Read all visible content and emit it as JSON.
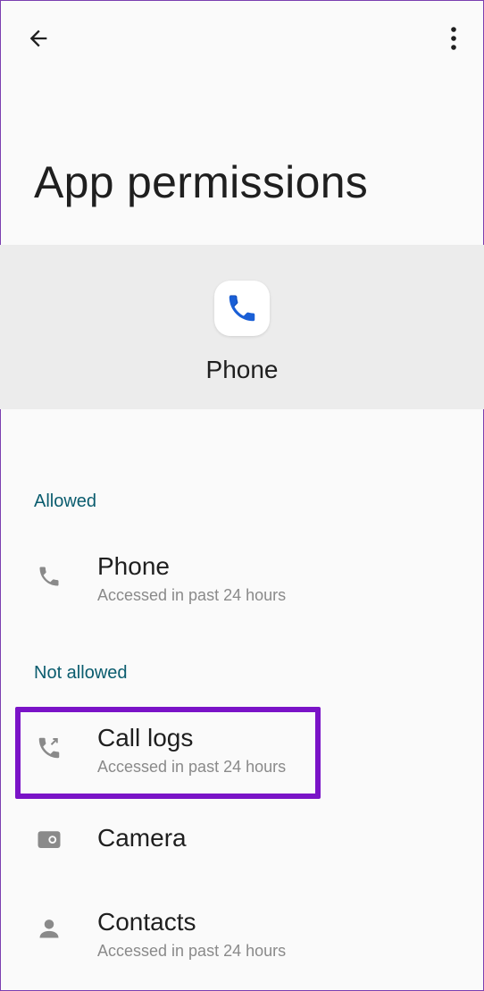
{
  "page": {
    "title": "App permissions"
  },
  "app": {
    "name": "Phone",
    "icon": "phone-app-icon"
  },
  "sections": {
    "allowed_label": "Allowed",
    "not_allowed_label": "Not allowed"
  },
  "permissions": {
    "phone": {
      "title": "Phone",
      "subtitle": "Accessed in past 24 hours",
      "icon": "phone-icon"
    },
    "call_logs": {
      "title": "Call logs",
      "subtitle": "Accessed in past 24 hours",
      "icon": "call-log-icon"
    },
    "camera": {
      "title": "Camera",
      "icon": "camera-icon"
    },
    "contacts": {
      "title": "Contacts",
      "subtitle": "Accessed in past 24 hours",
      "icon": "contacts-icon"
    }
  },
  "colors": {
    "accent": "#0a5c6e",
    "highlight": "#7a13c7",
    "app_icon_blue": "#1a5fd6"
  }
}
